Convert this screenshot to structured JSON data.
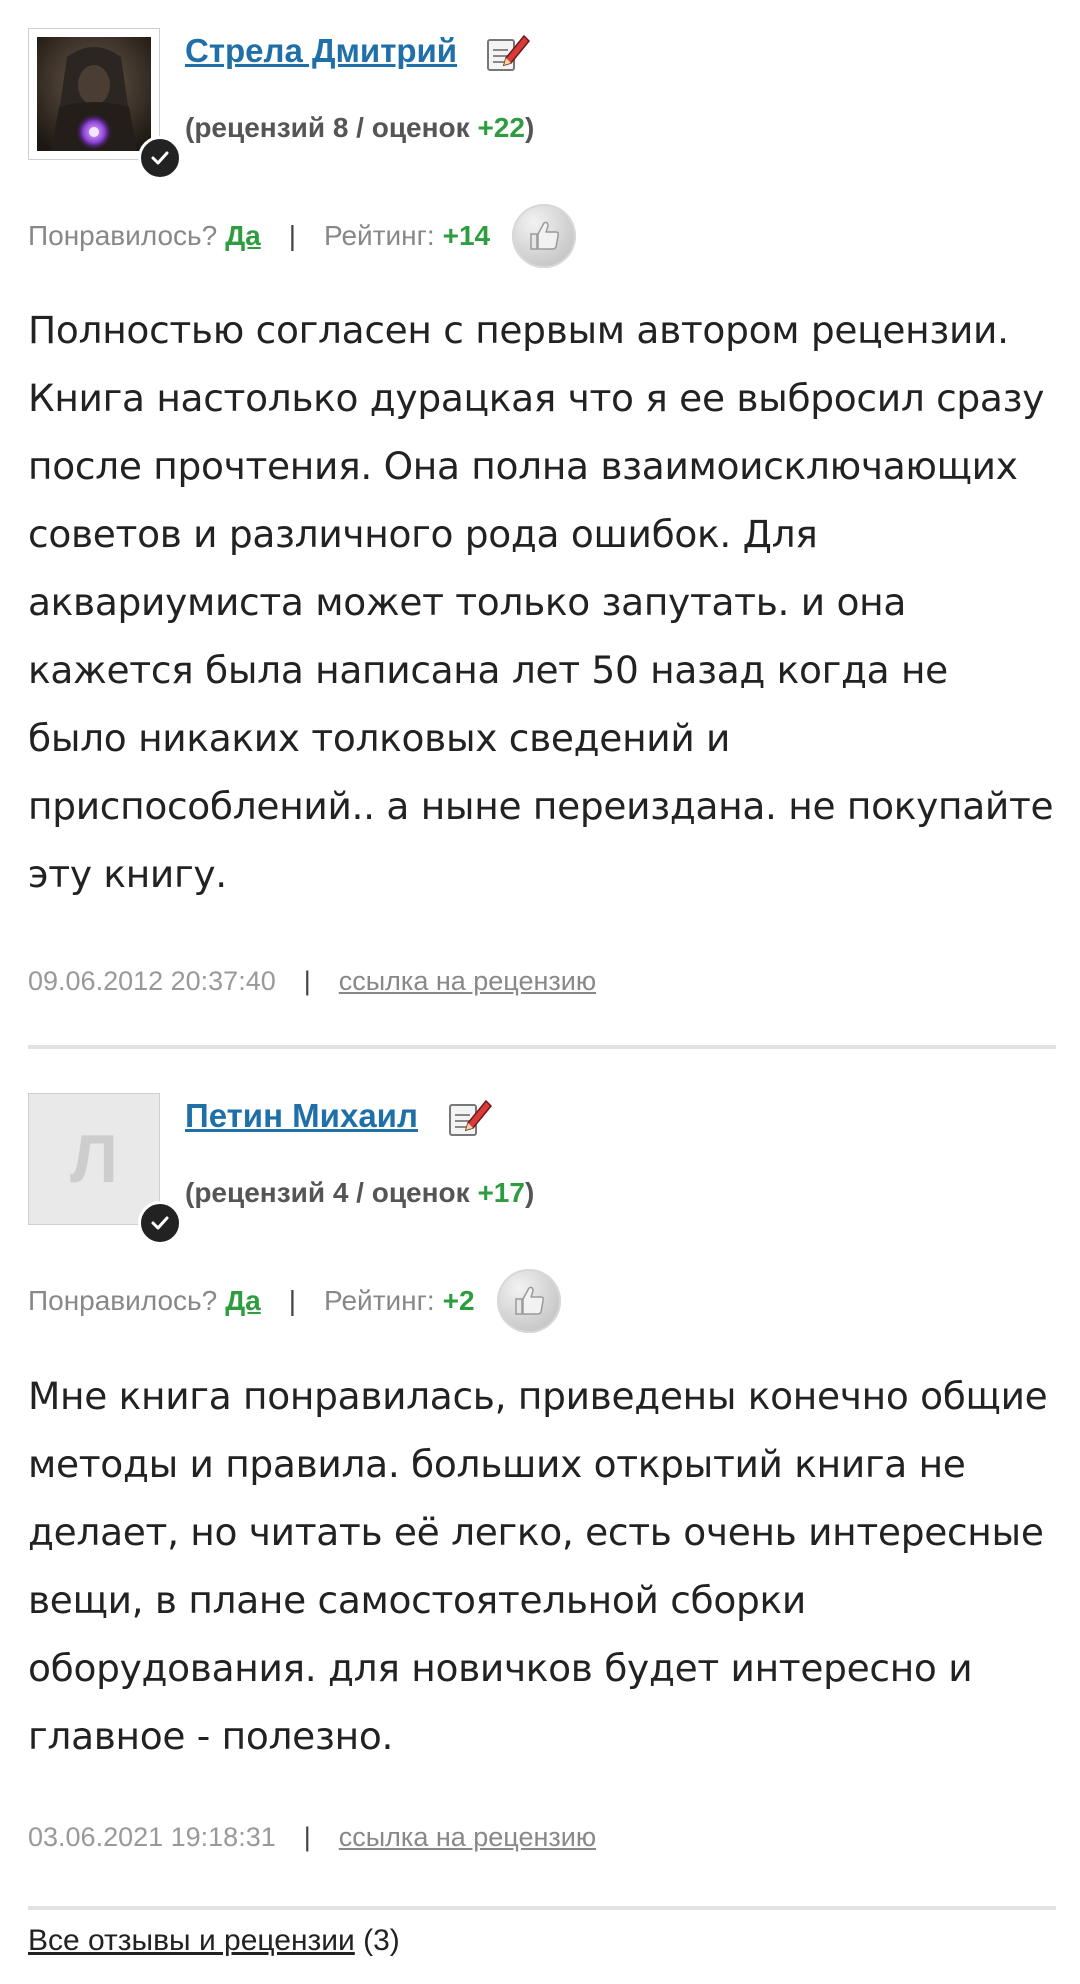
{
  "reviews": [
    {
      "author": "Стрела Дмитрий",
      "stats_prefix": "(рецензий 8 / оценок ",
      "stats_score": "+22",
      "stats_suffix": ")",
      "liked_label": "Понравилось?",
      "liked_value": "Да",
      "rating_label": "Рейтинг:",
      "rating_value": "+14",
      "text": "Полностью согласен с первым автором рецензии. Книга настолько дурацкая что я ее выбросил сразу после прочтения. Она полна взаимоисключающих советов и различного рода ошибок. Для аквариумиста может только запутать. и она кажется была написана лет 50 назад когда не было никаких толковых сведений и приспособлений.. а ныне переиздана. не покупайте эту книгу.",
      "date": "09.06.2012 20:37:40",
      "link_label": "ссылка на рецензию"
    },
    {
      "author": "Петин Михаил",
      "avatar_letter": "Л",
      "stats_prefix": "(рецензий 4 / оценок ",
      "stats_score": "+17",
      "stats_suffix": ")",
      "liked_label": "Понравилось?",
      "liked_value": "Да",
      "rating_label": "Рейтинг:",
      "rating_value": "+2",
      "text": "Мне книга понравилась, приведены конечно общие методы и правила. больших открытий книга не делает, но читать её легко, есть очень интересные вещи, в плане самостоятельной сборки оборудования. для новичков будет интересно и главное - полезно.",
      "date": "03.06.2021 19:18:31",
      "link_label": "ссылка на рецензию"
    }
  ],
  "separator": "|",
  "footer": {
    "link_label": "Все отзывы и рецензии",
    "count": "(3)"
  },
  "colors": {
    "author_link": "#1f6fa8",
    "positive": "#2e9d3f",
    "muted": "#888888"
  },
  "icons": [
    "avatar-image",
    "verified-check-icon",
    "edit-review-icon",
    "thumbs-up-icon"
  ]
}
